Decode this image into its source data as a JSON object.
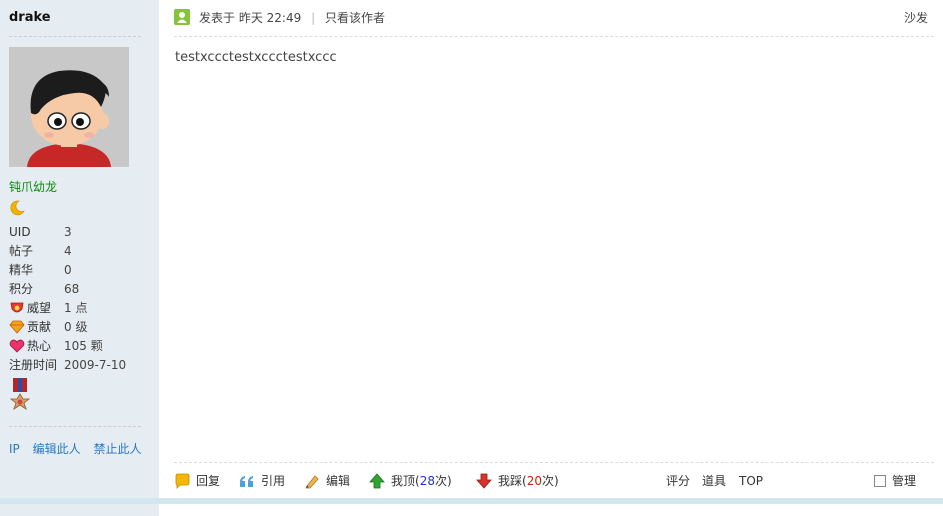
{
  "sidebar": {
    "username": "drake",
    "group_name": "钝爪幼龙",
    "stats": [
      {
        "key": "UID",
        "value": "3"
      },
      {
        "key": "帖子",
        "value": "4"
      },
      {
        "key": "精华",
        "value": "0"
      },
      {
        "key": "积分",
        "value": "68"
      },
      {
        "key": "威望",
        "value": "1 点",
        "icon": "prestige-icon"
      },
      {
        "key": "贡献",
        "value": "0 级",
        "icon": "contribution-icon"
      },
      {
        "key": "热心",
        "value": "105 颗",
        "icon": "enthusiasm-icon"
      },
      {
        "key": "注册时间",
        "value": "2009-7-10"
      }
    ],
    "links": {
      "ip": "IP",
      "edit": "编辑此人",
      "ban": "禁止此人"
    }
  },
  "post": {
    "posted_label": "发表于",
    "posted_time": "昨天 22:49",
    "author_only": "只看该作者",
    "floor": "沙发",
    "content": "testxccctestxccctestxccc"
  },
  "actions": {
    "reply": "回复",
    "quote": "引用",
    "edit": "编辑",
    "up_label": "我顶",
    "up_open": "(",
    "up_count": "28",
    "up_close": "次)",
    "down_label": "我踩",
    "down_open": "(",
    "down_count": "20",
    "down_close": "次)",
    "rate": "评分",
    "props": "道具",
    "top": "TOP",
    "manage": "管理"
  },
  "colors": {
    "sidebar_bg": "#e5edf2",
    "link": "#2b78c5",
    "group": "#0a8a0a",
    "up_count": "#2233cc",
    "down_count": "#d81e06"
  }
}
